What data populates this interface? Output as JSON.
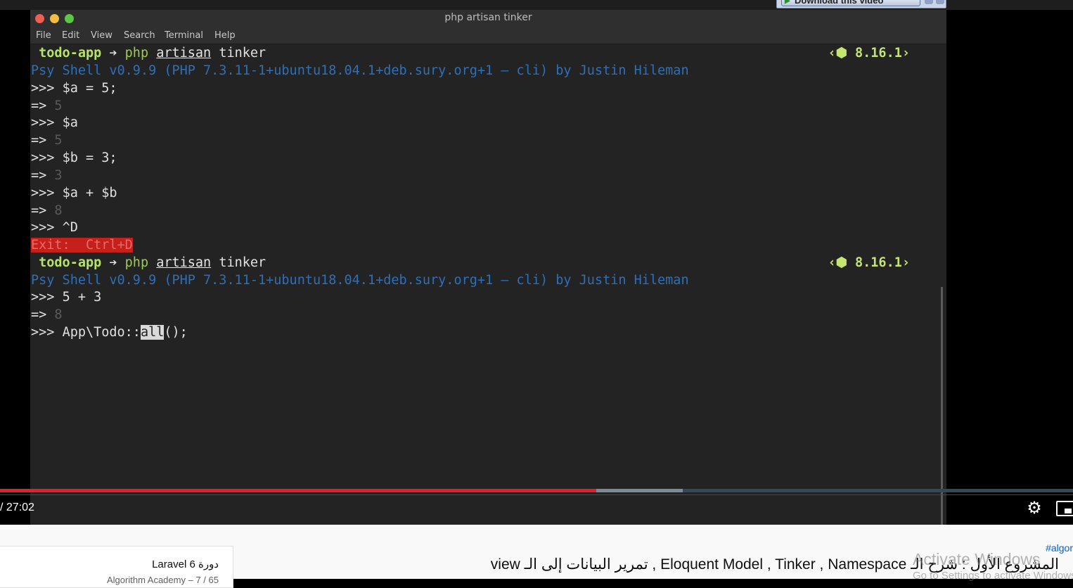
{
  "download_banner": {
    "label": "Download this video"
  },
  "terminal": {
    "window_title": "php artisan tinker",
    "menu": [
      "File",
      "Edit",
      "View",
      "Search",
      "Terminal",
      "Help"
    ],
    "prompt": {
      "dir": "todo-app",
      "arrow": "➔",
      "php": "php",
      "artisan": "artisan",
      "cmd": "tinker",
      "version": "‹⬢ 8.16.1›"
    },
    "psy_banner": "Psy Shell v0.9.9 (PHP 7.3.11-1+ubuntu18.04.1+deb.sury.org+1 — cli) by Justin Hileman",
    "session1": [
      {
        "prefix": ">>> ",
        "text": "$a = 5;"
      },
      {
        "prefix": "=> ",
        "value": "5"
      },
      {
        "prefix": ">>> ",
        "text": "$a"
      },
      {
        "prefix": "=> ",
        "value": "5"
      },
      {
        "prefix": ">>> ",
        "text": "$b = 3;"
      },
      {
        "prefix": "=> ",
        "value": "3"
      },
      {
        "prefix": ">>> ",
        "text": "$a + $b"
      },
      {
        "prefix": "=> ",
        "value": "8"
      },
      {
        "prefix": ">>> ",
        "text": "^D"
      }
    ],
    "exit_text": "Exit:  Ctrl+D",
    "session2": [
      {
        "prefix": ">>> ",
        "text": "5 + 3"
      },
      {
        "prefix": "=> ",
        "value": "8"
      }
    ],
    "current_input": {
      "prefix": ">>> ",
      "before": "App\\Todo::",
      "selected": "all",
      "after": "();"
    }
  },
  "player": {
    "time": "/ 27:02",
    "played_fraction": 0.556,
    "buffered_fraction": 0.636,
    "settings_icon": "gear-icon",
    "miniplayer_icon": "miniplayer-icon"
  },
  "below_video": {
    "playlist_title": "دورة Laravel 6",
    "playlist_subtitle": "65 / 7 – Algorithm Academy",
    "hashtag": "#algor",
    "video_title": "المشروع الأول : شرح الـ Eloquent Model , Tinker , Namespace , تمرير البيانات إلى الـ view",
    "watermark_line1": "Activate Windows",
    "watermark_line2": "Go to Settings to activate Windows."
  },
  "colors": {
    "terminal_bg": "#232323",
    "prompt_dir": "#b6e36a",
    "psy_banner": "#2e6fb8",
    "progress_played": "#e0202a",
    "exit_bg": "#c5201b"
  }
}
